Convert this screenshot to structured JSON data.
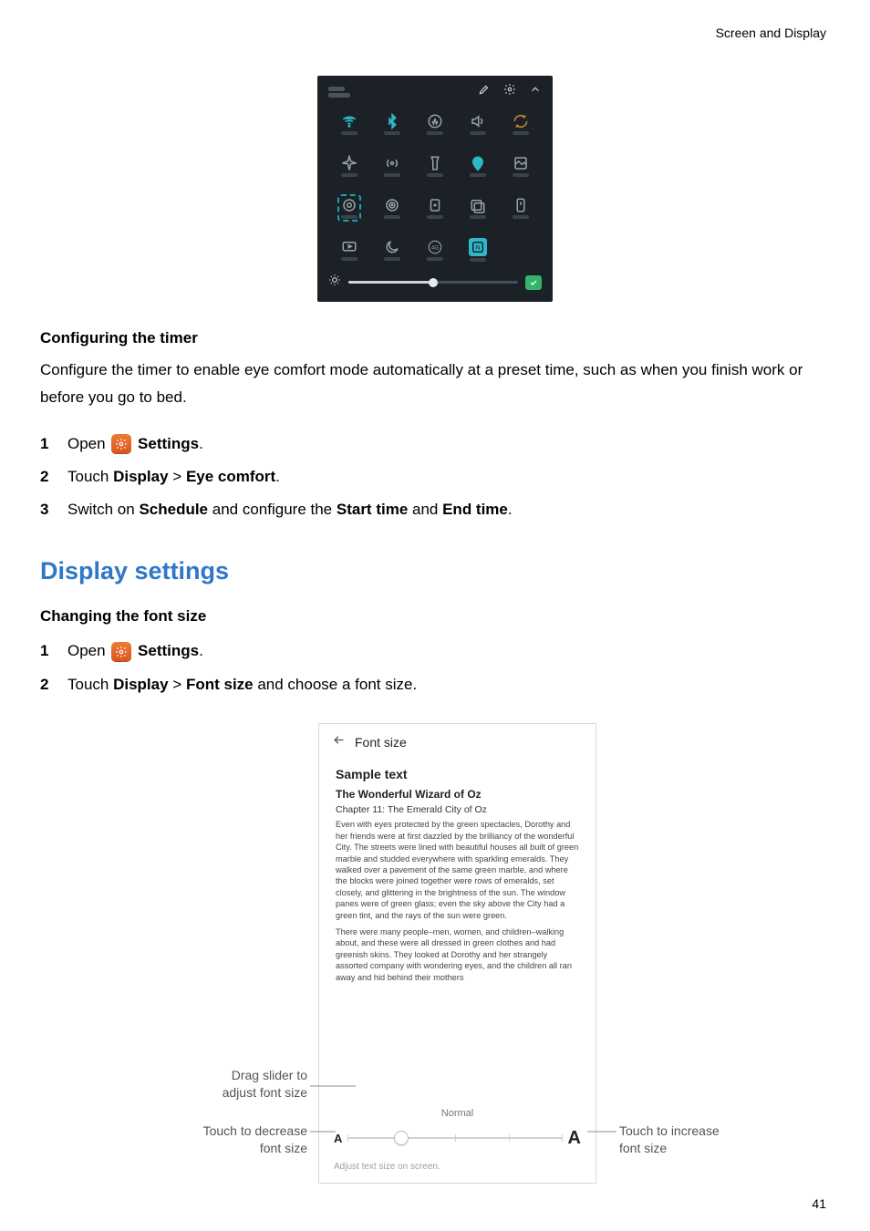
{
  "page": {
    "header_right": "Screen and Display",
    "number": "41"
  },
  "timer": {
    "heading": "Configuring the timer",
    "body": "Configure the timer to enable eye comfort mode automatically at a preset time, such as when you finish work or before you go to bed.",
    "steps": {
      "s1_num": "1",
      "s1_a": "Open ",
      "s1_b": "Settings",
      "s1_c": ".",
      "s2_num": "2",
      "s2_a": "Touch ",
      "s2_b": "Display",
      "s2_c": " > ",
      "s2_d": "Eye comfort",
      "s2_e": ".",
      "s3_num": "3",
      "s3_a": "Switch on ",
      "s3_b": "Schedule",
      "s3_c": " and configure the ",
      "s3_d": "Start time",
      "s3_e": " and ",
      "s3_f": "End time",
      "s3_g": "."
    }
  },
  "display": {
    "h2": "Display settings",
    "font_heading": "Changing the font size",
    "steps": {
      "s1_num": "1",
      "s1_a": "Open ",
      "s1_b": "Settings",
      "s1_c": ".",
      "s2_num": "2",
      "s2_a": "Touch ",
      "s2_b": "Display",
      "s2_c": " > ",
      "s2_d": "Font size",
      "s2_e": " and choose a font size."
    }
  },
  "phone": {
    "title": "Font size",
    "sample_title": "Sample text",
    "book_title": "The Wonderful Wizard of Oz",
    "chapter": "Chapter 11: The Emerald City of Oz",
    "p1": "Even with eyes protected by the green spectacles, Dorothy and her friends were at first dazzled by the brilliancy of the wonderful City. The streets were lined with beautiful houses all built of green marble and studded everywhere with sparkling emeralds. They walked over a pavement of the same green marble, and where the blocks were joined together were rows of emeralds, set closely, and glittering in the brightness of the sun. The window panes were of green glass; even the sky above the City had a green tint, and the rays of the sun were green.",
    "p2": "There were many people–men, women, and children–walking about, and these were all dressed in green clothes and had greenish skins. They looked at Dorothy and her strangely assorted company with wondering eyes, and the children all ran away and hid behind their mothers",
    "slider_label": "Normal",
    "a_small": "A",
    "a_big": "A",
    "hint": "Adjust text size on screen."
  },
  "callouts": {
    "drag_l1": "Drag slider to",
    "drag_l2": "adjust font size",
    "dec_l1": "Touch to decrease",
    "dec_l2": "font size",
    "inc_l1": "Touch to increase",
    "inc_l2": "font size"
  }
}
